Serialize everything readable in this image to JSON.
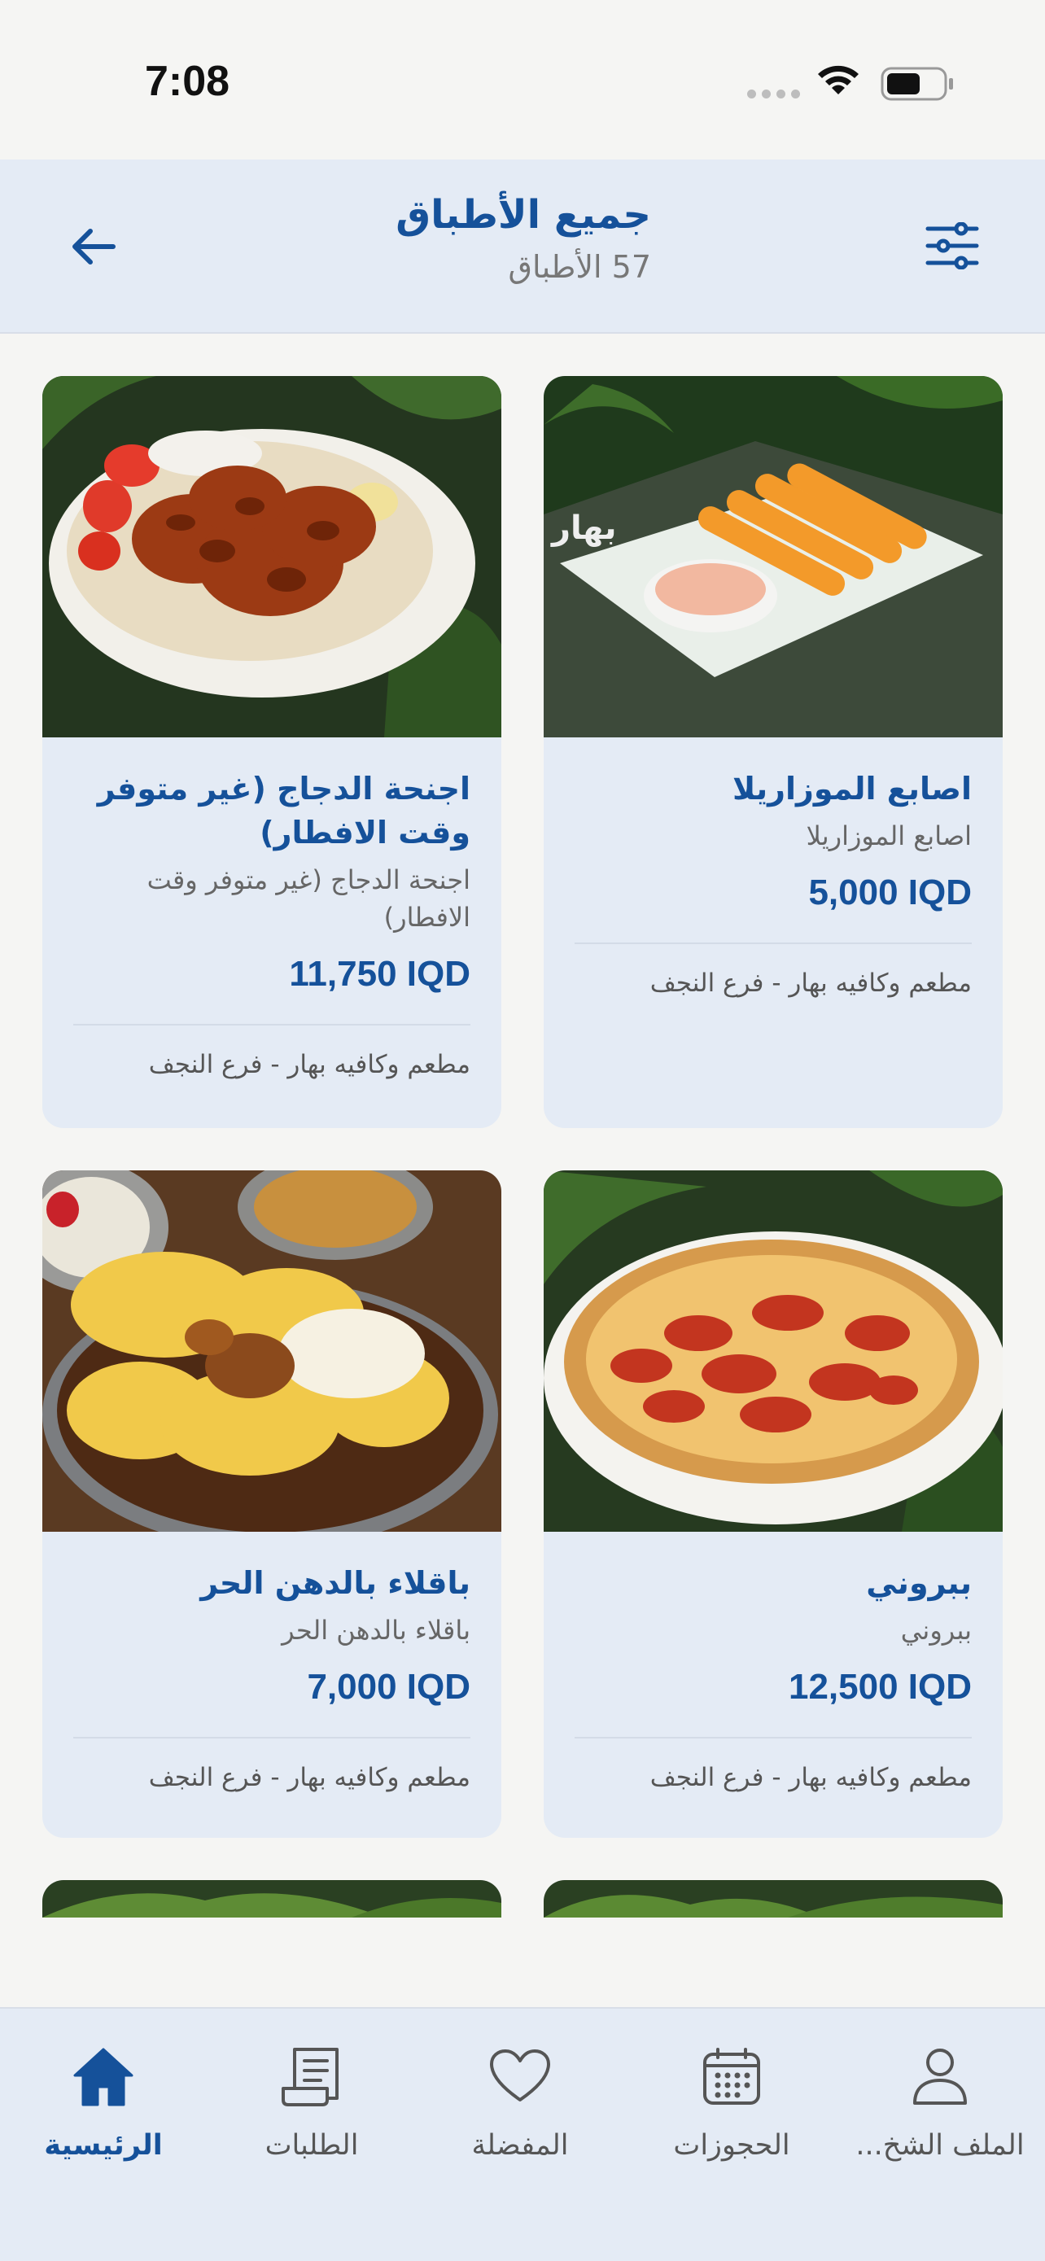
{
  "status_bar": {
    "time": "7:08"
  },
  "header": {
    "title": "جميع الأطباق",
    "subtitle": "57 الأطباق"
  },
  "dishes": [
    {
      "name": "اصابع الموزاريلا",
      "description": "اصابع الموزاريلا",
      "price": "5,000 IQD",
      "restaurant": "مطعم وكافيه بهار - فرع النجف"
    },
    {
      "name": "اجنحة الدجاج (غير متوفر وقت الافطار)",
      "description": "اجنحة الدجاج (غير متوفر وقت الافطار)",
      "price": "11,750 IQD",
      "restaurant": "مطعم وكافيه بهار - فرع النجف"
    },
    {
      "name": "ببروني",
      "description": "ببروني",
      "price": "12,500 IQD",
      "restaurant": "مطعم وكافيه بهار - فرع النجف"
    },
    {
      "name": "باقلاء بالدهن الحر",
      "description": "باقلاء بالدهن الحر",
      "price": "7,000 IQD",
      "restaurant": "مطعم وكافيه بهار - فرع النجف"
    }
  ],
  "tabs": [
    {
      "label": "الرئيسية",
      "icon": "home-icon",
      "active": true
    },
    {
      "label": "الطلبات",
      "icon": "receipt-icon",
      "active": false
    },
    {
      "label": "المفضلة",
      "icon": "heart-icon",
      "active": false
    },
    {
      "label": "الحجوزات",
      "icon": "calendar-icon",
      "active": false
    },
    {
      "label": "الملف الشخ...",
      "icon": "profile-icon",
      "active": false
    }
  ],
  "colors": {
    "accent": "#15519a",
    "header_bg": "#e4ebf5",
    "page_bg": "#f5f5f3"
  }
}
